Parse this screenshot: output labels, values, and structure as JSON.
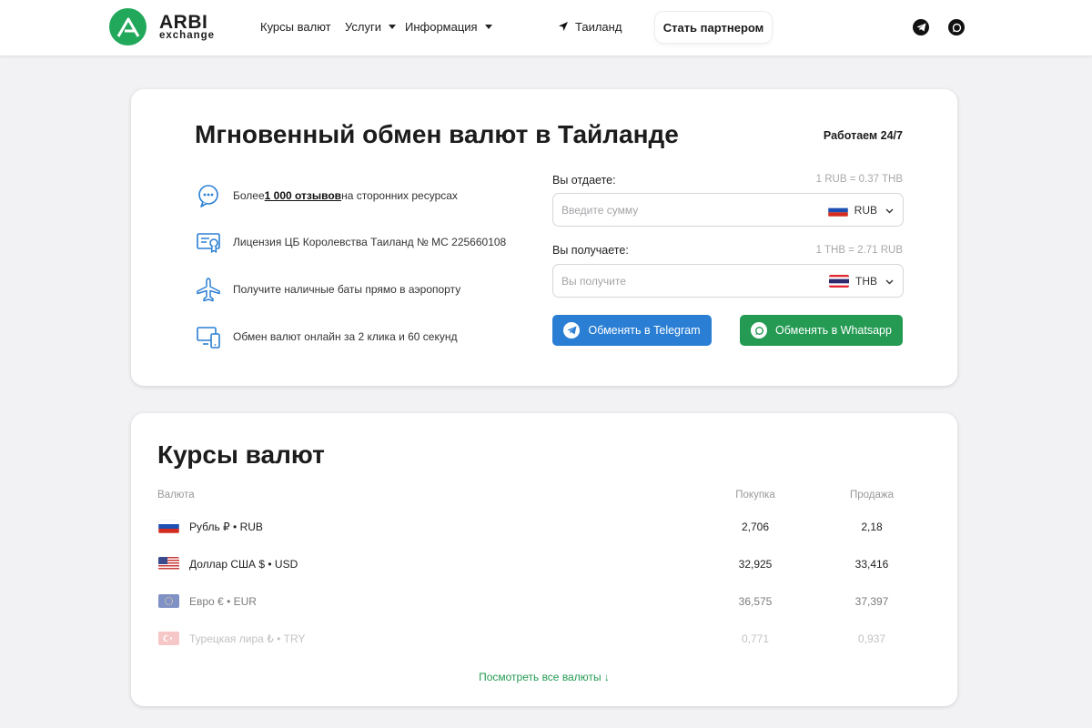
{
  "header": {
    "logo": {
      "line1": "ARBI",
      "line2": "exchange"
    },
    "nav": {
      "rates": "Курсы валют",
      "services": "Услуги",
      "info": "Информация",
      "location": "Таиланд"
    },
    "partner_button": "Стать партнером",
    "socials": [
      "telegram-icon",
      "whatsapp-icon"
    ]
  },
  "hero": {
    "title": "Мгновенный обмен валют в Тайланде",
    "hours": "Работаем 24/7",
    "features": [
      {
        "icon": "chat-icon",
        "before": "Более ",
        "bold": "1 000 отзывов",
        "after": " на сторонних ресурсах"
      },
      {
        "icon": "license-icon",
        "before": "Лицензия ЦБ Королевства Таиланд № MC 225660108",
        "bold": "",
        "after": ""
      },
      {
        "icon": "airplane-icon",
        "before": "Получите наличные баты прямо в аэропорту",
        "bold": "",
        "after": ""
      },
      {
        "icon": "devices-icon",
        "before": "Обмен валют онлайн за 2 клика и 60 секунд",
        "bold": "",
        "after": ""
      }
    ]
  },
  "exchange": {
    "give": {
      "label": "Вы отдаете:",
      "rate": "1 RUB = 0.37 THB",
      "placeholder": "Введите сумму",
      "currency": "RUB"
    },
    "get": {
      "label": "Вы получаете:",
      "rate": "1 THB = 2.71 RUB",
      "placeholder": "Вы получите",
      "currency": "THB"
    },
    "telegram_button": "Обменять в Telegram",
    "whatsapp_button": "Обменять в Whatsapp"
  },
  "rates": {
    "title": "Курсы валют",
    "headers": {
      "currency": "Валюта",
      "buy": "Покупка",
      "sell": "Продажа"
    },
    "rows": [
      {
        "name": "Рубль ₽ • RUB",
        "buy": "2,706",
        "sell": "2,18"
      },
      {
        "name": "Доллар США $ • USD",
        "buy": "32,925",
        "sell": "33,416"
      },
      {
        "name": "Евро € • EUR",
        "buy": "36,575",
        "sell": "37,397"
      },
      {
        "name": "Турецкая лира ₺ • TRY",
        "buy": "0,771",
        "sell": "0,937"
      }
    ],
    "see_all": "Посмотреть все валюты ↓"
  },
  "colors": {
    "brand_green": "#22a85b",
    "telegram_blue": "#2a7fd4",
    "whatsapp_green": "#249a53"
  }
}
